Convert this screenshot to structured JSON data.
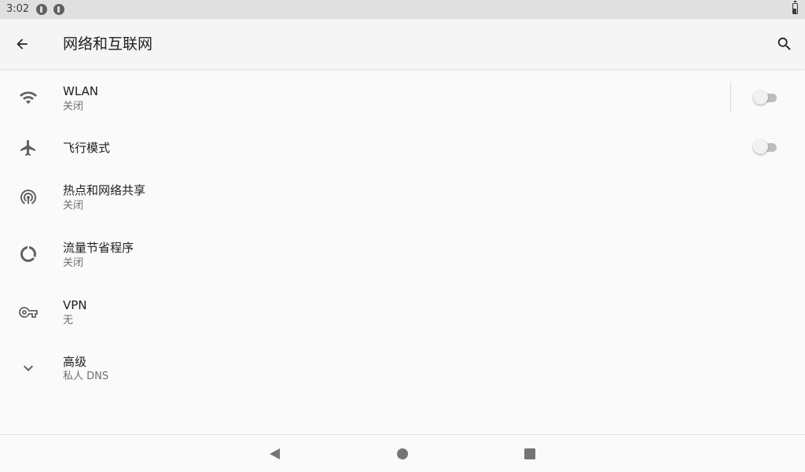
{
  "status_bar": {
    "time": "3:02",
    "icons": [
      "notification-icon",
      "notification-icon",
      "battery-icon"
    ]
  },
  "app_bar": {
    "title": "网络和互联网",
    "back_icon": "arrow-back-icon",
    "search_icon": "search-icon"
  },
  "items": [
    {
      "title": "WLAN",
      "summary": "关闭",
      "icon": "wifi-icon",
      "toggle": false
    },
    {
      "title": "飞行模式",
      "summary": "",
      "icon": "airplane-icon",
      "toggle": false
    },
    {
      "title": "热点和网络共享",
      "summary": "关闭",
      "icon": "hotspot-icon"
    },
    {
      "title": "流量节省程序",
      "summary": "关闭",
      "icon": "data-saver-icon"
    },
    {
      "title": "VPN",
      "summary": "无",
      "icon": "vpn-key-icon"
    },
    {
      "title": "高级",
      "summary": "私人 DNS",
      "icon": "chevron-down-icon"
    }
  ],
  "nav_bar": {
    "buttons": [
      "back-triangle-icon",
      "home-circle-icon",
      "recents-square-icon"
    ]
  },
  "colors": {
    "icon": "#5f6368",
    "title": "#202124",
    "summary": "#6f6f6f",
    "toggle_track_off": "#bdbdbd",
    "toggle_thumb_off": "#f1f1f1"
  }
}
